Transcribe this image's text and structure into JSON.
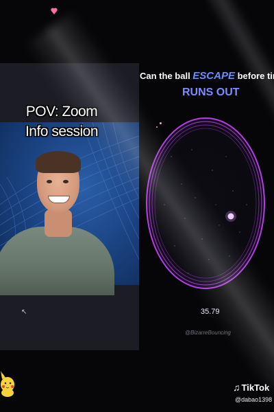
{
  "caption": {
    "line1": "POV: Zoom",
    "line2": "Info session"
  },
  "game": {
    "title_before": "Can the ball ",
    "title_accent": "ESCAPE",
    "title_after": " before time",
    "title_line2": "RUNS OUT",
    "timer": "35.79",
    "watermark": "@BizarreBouncing",
    "accent_color": "#6b8cff",
    "ring_color": "#b040e0"
  },
  "tiktok": {
    "logo": "TikTok",
    "username": "@dabao1398"
  }
}
